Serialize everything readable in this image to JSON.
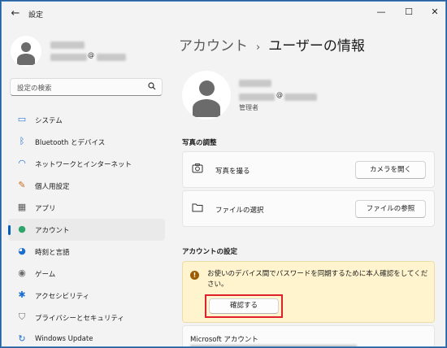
{
  "window": {
    "title": "設定",
    "back_icon": "←",
    "minimize_icon": "—",
    "maximize_icon": "☐",
    "close_icon": "✕"
  },
  "sidebar": {
    "user": {
      "email_at": "@"
    },
    "search": {
      "placeholder": "設定の検索",
      "icon": "search-icon"
    },
    "items": [
      {
        "label": "システム",
        "icon": "display-icon",
        "glyph": "▭",
        "color": "#2e7bd6"
      },
      {
        "label": "Bluetooth とデバイス",
        "icon": "bluetooth-icon",
        "glyph": "ᛒ",
        "color": "#1c6fd1"
      },
      {
        "label": "ネットワークとインターネット",
        "icon": "wifi-icon",
        "glyph": "◠",
        "color": "#1c6fd1"
      },
      {
        "label": "個人用設定",
        "icon": "brush-icon",
        "glyph": "✎",
        "color": "#c56a1a"
      },
      {
        "label": "アプリ",
        "icon": "apps-icon",
        "glyph": "▦",
        "color": "#5a5a5a"
      },
      {
        "label": "アカウント",
        "icon": "person-icon",
        "glyph": "●",
        "color": "#2ca56a",
        "active": true
      },
      {
        "label": "時刻と言語",
        "icon": "globe-clock-icon",
        "glyph": "◕",
        "color": "#1c6fd1"
      },
      {
        "label": "ゲーム",
        "icon": "gamepad-icon",
        "glyph": "◉",
        "color": "#6b6b6b"
      },
      {
        "label": "アクセシビリティ",
        "icon": "accessibility-icon",
        "glyph": "✱",
        "color": "#1c6fd1"
      },
      {
        "label": "プライバシーとセキュリティ",
        "icon": "shield-icon",
        "glyph": "⛉",
        "color": "#6b6b6b"
      },
      {
        "label": "Windows Update",
        "icon": "update-icon",
        "glyph": "↻",
        "color": "#1c6fd1"
      }
    ]
  },
  "main": {
    "breadcrumb": {
      "parent": "アカウント",
      "separator": "›",
      "current": "ユーザーの情報"
    },
    "user": {
      "email_at": "@",
      "role": "管理者"
    },
    "photo_section": {
      "title": "写真の調整",
      "rows": [
        {
          "label": "写真を撮る",
          "button": "カメラを開く",
          "icon": "camera-icon",
          "glyph": "⊙"
        },
        {
          "label": "ファイルの選択",
          "button": "ファイルの参照",
          "icon": "folder-icon",
          "glyph": "▭"
        }
      ]
    },
    "account_section": {
      "title": "アカウントの設定",
      "alert": {
        "icon": "warning-icon",
        "glyph": "!",
        "text": "お使いのデバイス間でパスワードを同期するために本人確認をしてください。",
        "button": "確認する"
      },
      "microsoft_account": {
        "title": "Microsoft アカウント"
      }
    }
  },
  "colors": {
    "accent": "#005fb8",
    "alert_bg": "#fff4ce",
    "highlight": "#e0202a"
  }
}
